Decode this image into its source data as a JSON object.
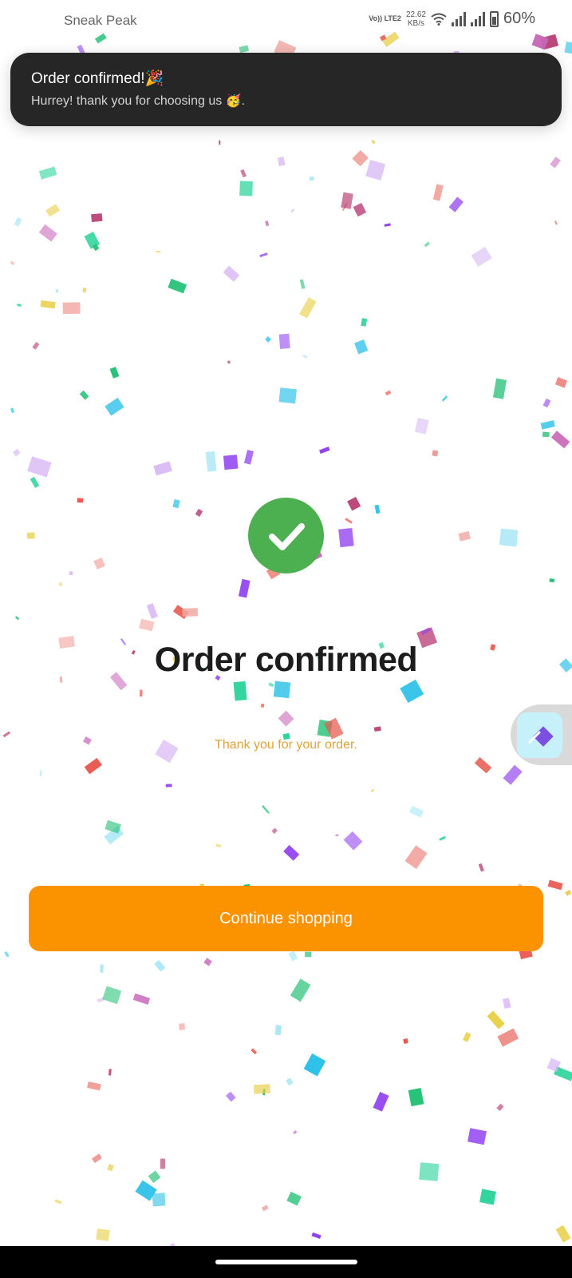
{
  "status_bar": {
    "app_name": "Sneak Peak",
    "volte": "Vo)) LTE2",
    "speed_value": "22.62",
    "speed_unit": "KB/s",
    "battery": "60%"
  },
  "toast": {
    "title": "Order confirmed!🎉",
    "message": "Hurrey! thank you for choosing us 🥳."
  },
  "main": {
    "title": "Order confirmed",
    "subtitle": "Thank you for your order.",
    "cta_label": "Continue shopping"
  },
  "colors": {
    "success": "#4caf50",
    "accent": "#fb9300",
    "subtitle": "#dda33a",
    "toast_bg": "#262626"
  },
  "icons": {
    "check": "check-icon",
    "side_tool": "edit-icon"
  }
}
